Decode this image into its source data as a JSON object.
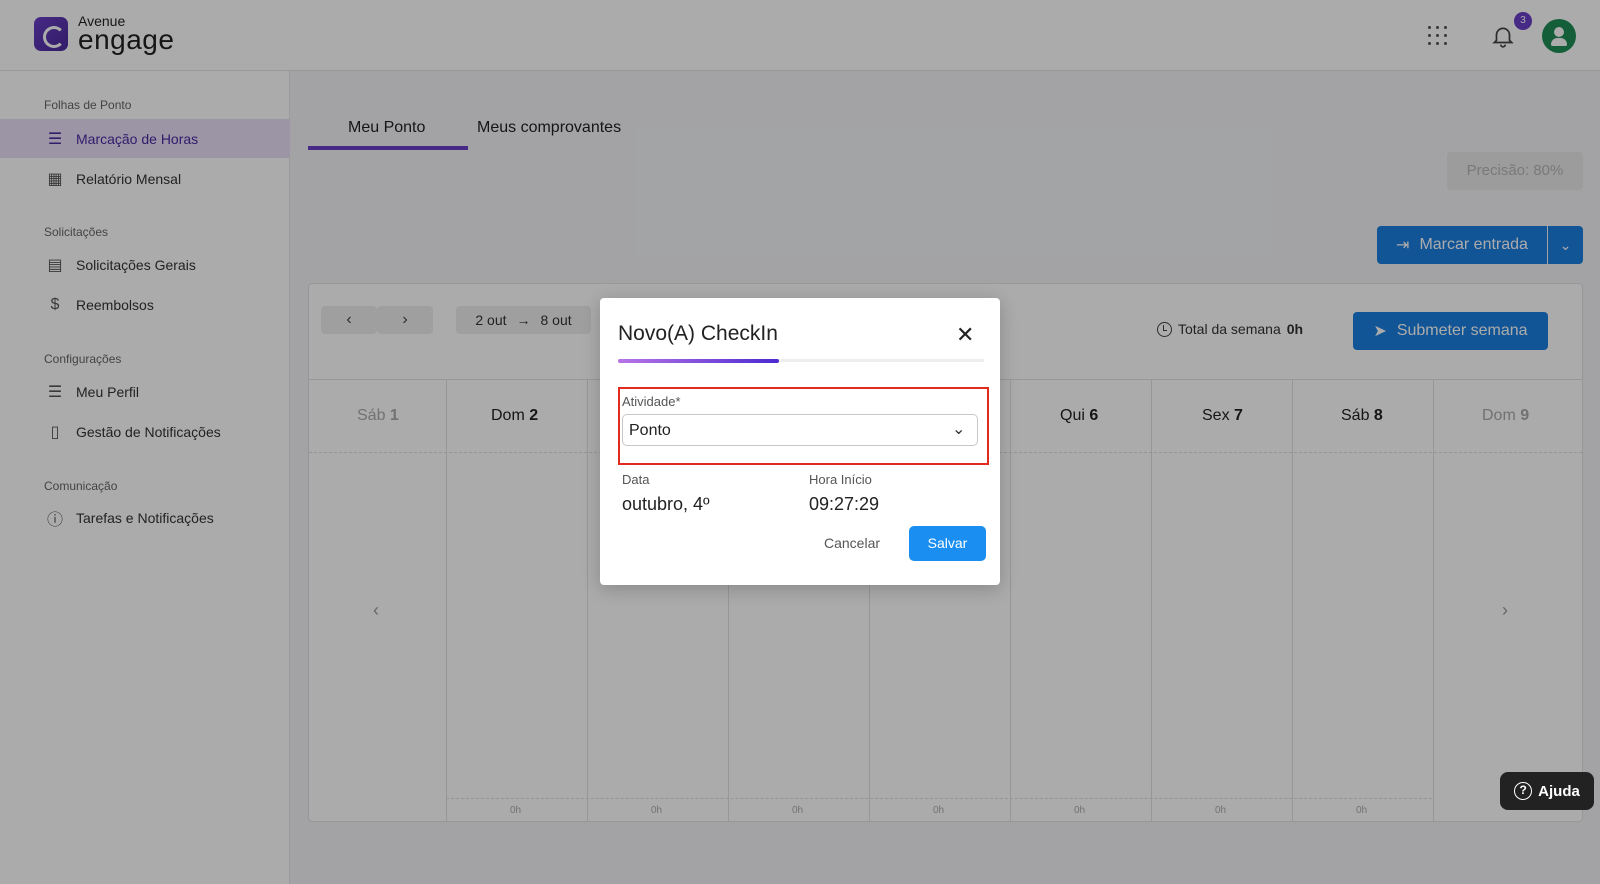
{
  "header": {
    "logo_small": "Avenue",
    "logo_big": "engage",
    "notification_count": "3"
  },
  "sidebar": {
    "sections": [
      {
        "title": "Folhas de Ponto"
      },
      {
        "title": "Solicitações"
      },
      {
        "title": "Configurações"
      },
      {
        "title": "Comunicação"
      }
    ],
    "items": [
      {
        "label": "Marcação de Horas",
        "icon": "list-icon",
        "active": true
      },
      {
        "label": "Relatório Mensal",
        "icon": "calendar-icon"
      },
      {
        "label": "Solicitações Gerais",
        "icon": "document-icon"
      },
      {
        "label": "Reembolsos",
        "icon": "dollar-icon"
      },
      {
        "label": "Meu Perfil",
        "icon": "menu-list-icon"
      },
      {
        "label": "Gestão de Notificações",
        "icon": "file-icon"
      },
      {
        "label": "Tarefas e Notificações",
        "icon": "info-icon"
      }
    ]
  },
  "tabs": [
    {
      "label": "Meu Ponto",
      "active": true
    },
    {
      "label": "Meus comprovantes"
    }
  ],
  "toolbar": {
    "precisao": "Precisão: 80%",
    "marcar_entrada": "Marcar entrada",
    "range_start": "2 out",
    "range_end": "8 out",
    "total_label": "Total da semana",
    "total_value": "0h",
    "submeter": "Submeter semana"
  },
  "days": [
    {
      "name": "Sáb",
      "num": "1",
      "dim": true
    },
    {
      "name": "Dom",
      "num": "2"
    },
    {
      "name": "Qui",
      "num": "6"
    },
    {
      "name": "Sex",
      "num": "7"
    },
    {
      "name": "Sáb",
      "num": "8"
    },
    {
      "name": "Dom",
      "num": "9",
      "dim": true
    }
  ],
  "day_total": "0h",
  "help_label": "Ajuda",
  "modal": {
    "title": "Novo(A) CheckIn",
    "activity_label": "Atividade*",
    "activity_value": "Ponto",
    "date_label": "Data",
    "date_value": "outubro, 4º",
    "time_label": "Hora Início",
    "time_value": "09:27:29",
    "cancel_label": "Cancelar",
    "save_label": "Salvar",
    "progress": 0.44
  },
  "colors": {
    "accent": "#6a3fc7",
    "primary_button": "#1a7fe0",
    "highlight": "#e22b1e"
  }
}
